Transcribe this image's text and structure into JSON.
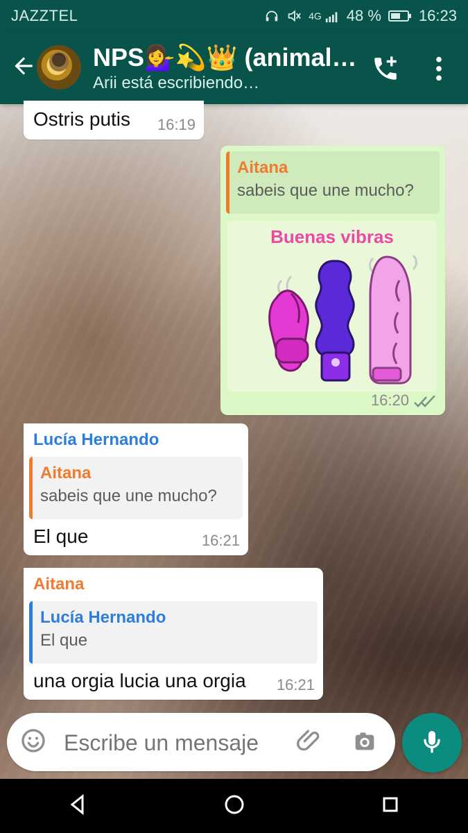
{
  "status_bar": {
    "carrier": "JAZZTEL",
    "network": "4G",
    "battery": "48 %",
    "time": "16:23"
  },
  "header": {
    "title": "NPS💁‍♀️💫👑 (animalist…",
    "subtitle": "Arii está escribiendo…",
    "icons": {
      "back": "back-arrow-icon",
      "avatar": "group-avatar",
      "call": "add-call-icon",
      "menu": "more-vert-icon"
    }
  },
  "messages": [
    {
      "direction": "incoming",
      "text": "Ostris putis",
      "time": "16:19"
    },
    {
      "direction": "outgoing",
      "quote": {
        "sender": "Aitana",
        "text": "sabeis que une mucho?"
      },
      "image_title": "Buenas vibras",
      "time": "16:20",
      "status": "read"
    },
    {
      "direction": "incoming",
      "sender": "Lucía Hernando",
      "quote": {
        "sender": "Aitana",
        "text": "sabeis que une mucho?"
      },
      "text": "El que",
      "time": "16:21"
    },
    {
      "direction": "incoming",
      "sender": "Aitana",
      "quote": {
        "sender": "Lucía Hernando",
        "text": "El que"
      },
      "text": "una orgia lucia una orgia",
      "time": "16:21"
    }
  ],
  "composer": {
    "placeholder": "Escribe un mensaje",
    "icons": {
      "emoji": "emoji-icon",
      "attach": "paperclip-icon",
      "camera": "camera-icon",
      "mic": "mic-icon"
    }
  },
  "colors": {
    "header_bg": "#08544b",
    "outgoing_bubble": "#dcf8c6",
    "incoming_bubble": "#ffffff",
    "accent_orange": "#f07a2f",
    "accent_blue": "#2c7ddc",
    "mic_button": "#0c8c7e"
  }
}
